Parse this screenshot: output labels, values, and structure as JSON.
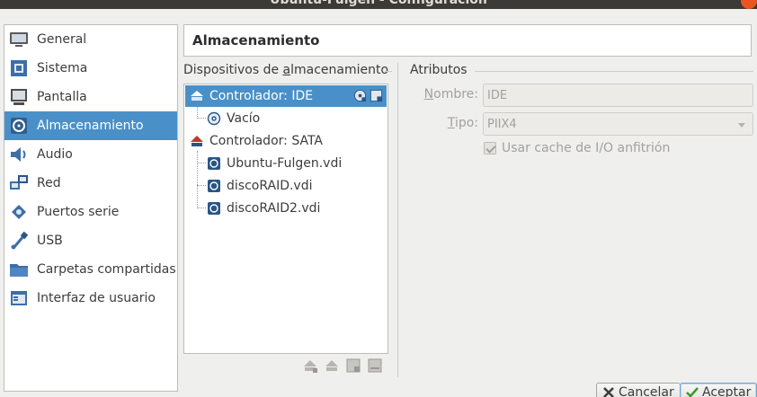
{
  "window": {
    "title": "Ubuntu-Fulgen - Configuración"
  },
  "sidebar": {
    "items": [
      {
        "label": "General",
        "icon": "monitor-general-icon"
      },
      {
        "label": "Sistema",
        "icon": "chip-icon"
      },
      {
        "label": "Pantalla",
        "icon": "display-icon"
      },
      {
        "label": "Almacenamiento",
        "icon": "disk-icon",
        "selected": true
      },
      {
        "label": "Audio",
        "icon": "speaker-icon"
      },
      {
        "label": "Red",
        "icon": "network-icon"
      },
      {
        "label": "Puertos serie",
        "icon": "serial-port-icon"
      },
      {
        "label": "USB",
        "icon": "usb-icon"
      },
      {
        "label": "Carpetas compartidas",
        "icon": "folder-icon"
      },
      {
        "label": "Interfaz de usuario",
        "icon": "ui-window-icon"
      }
    ]
  },
  "page": {
    "title": "Almacenamiento"
  },
  "storage": {
    "label_before": "Dispositivos de ",
    "label_mnemonic": "a",
    "label_after": "lmacenamiento",
    "tree": {
      "ide_controller": "Controlador: IDE",
      "ide_empty": "Vacío",
      "sata_controller": "Controlador: SATA",
      "disks": [
        "Ubuntu-Fulgen.vdi",
        "discoRAID.vdi",
        "discoRAID2.vdi"
      ]
    }
  },
  "attributes": {
    "group_label": "Atributos",
    "name_label_mnemonic": "N",
    "name_label_rest": "ombre:",
    "name_value": "IDE",
    "type_label_mnemonic": "T",
    "type_label_rest": "ipo:",
    "type_value": "PIIX4",
    "cache_label": "Usar cache de I/O anfitrión"
  },
  "buttons": {
    "cancel_label": "Cancelar",
    "accept_label": "Aceptar"
  },
  "colors": {
    "selection": "#4a90c8",
    "titlebar": "#3b3a36",
    "close": "#e95420"
  }
}
